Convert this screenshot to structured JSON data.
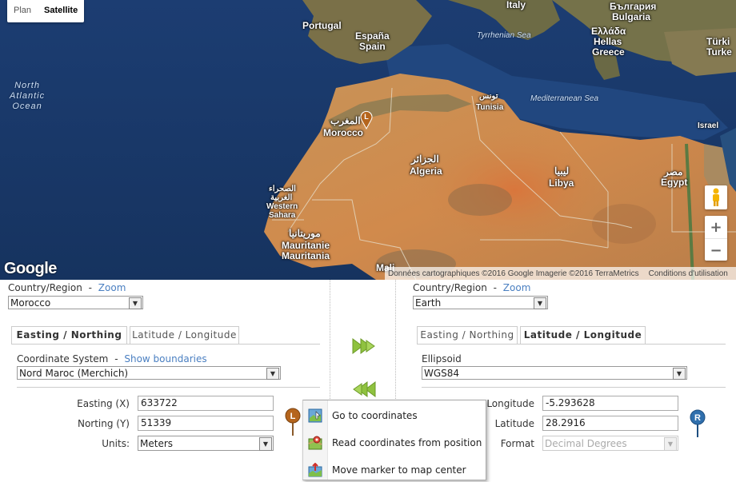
{
  "map": {
    "type_buttons": [
      "Plan",
      "Satellite"
    ],
    "active_type": "Satellite",
    "labels": {
      "italy": "Italy",
      "bulgaria_bg": "България",
      "bulgaria": "Bulgaria",
      "greece_gr": "Ελλάδα",
      "hellas": "Hellas",
      "greece": "Greece",
      "turkey_tr": "Türki",
      "turkey": "Turke",
      "portugal": "Portugal",
      "espana": "España",
      "spain": "Spain",
      "tyrrhenian": "Tyrrhenian Sea",
      "tunisia_ar": "تونس",
      "tunisia": "Tunisia",
      "mediterranean": "Mediterranean Sea",
      "north_atlantic": "North\nAtlantic\nOcean",
      "morocco_ar": "المغرب",
      "morocco": "Morocco",
      "israel": "Israel",
      "algeria_ar": "الجزائر",
      "algeria": "Algeria",
      "libya_ar": "ليبيا",
      "libya": "Libya",
      "egypt_ar": "مصر",
      "egypt": "Egypt",
      "ws_ar1": "الصحراء",
      "ws_ar2": "الغربية",
      "western_sahara1": "Western",
      "western_sahara2": "Sahara",
      "mauritania_ar": "موريتانيا",
      "mauritanie": "Mauritanie",
      "mauritania": "Mauritania",
      "mali": "Mali"
    },
    "google_logo": "Google",
    "attribution": "Données cartographiques ©2016 Google Imagerie ©2016 TerraMetrics",
    "terms": "Conditions d'utilisation",
    "zoom_in": "+",
    "zoom_out": "−",
    "marker_letter": "L"
  },
  "left": {
    "country_label": "Country/Region",
    "separator": "-",
    "zoom_link": "Zoom",
    "country_value": "Morocco",
    "tabs": [
      "Easting / Northing",
      "Latitude / Longitude"
    ],
    "active_tab": "Easting / Northing",
    "coord_system_label": "Coordinate System",
    "show_boundaries": "Show boundaries",
    "coord_system_value": "Nord Maroc (Merchich)",
    "easting_label": "Easting (X)",
    "easting_value": "633722",
    "northing_label": "Norting (Y)",
    "northing_value": "51339",
    "units_label": "Units:",
    "units_value": "Meters",
    "marker_letter": "L"
  },
  "right": {
    "country_label": "Country/Region",
    "separator": "-",
    "zoom_link": "Zoom",
    "country_value": "Earth",
    "tabs": [
      "Easting / Northing",
      "Latitude / Longitude"
    ],
    "active_tab": "Latitude / Longitude",
    "ellipsoid_label": "Ellipsoid",
    "ellipsoid_value": "WGS84",
    "longitude_label": "Longitude",
    "longitude_value": "-5.293628",
    "latitude_label": "Latitude",
    "latitude_value": "28.2916",
    "format_label": "Format",
    "format_value": "Decimal Degrees",
    "marker_letter": "R"
  },
  "context_menu": {
    "items": [
      "Go to coordinates",
      "Read coordinates from position",
      "Move marker to map center"
    ]
  },
  "colors": {
    "link": "#4a7fc1",
    "arrow_green": "#8fc23f",
    "marker_left": "#b5651d",
    "marker_right": "#2f6fad",
    "ocean": "#1d3d6e",
    "desert": "#c88a4e"
  }
}
